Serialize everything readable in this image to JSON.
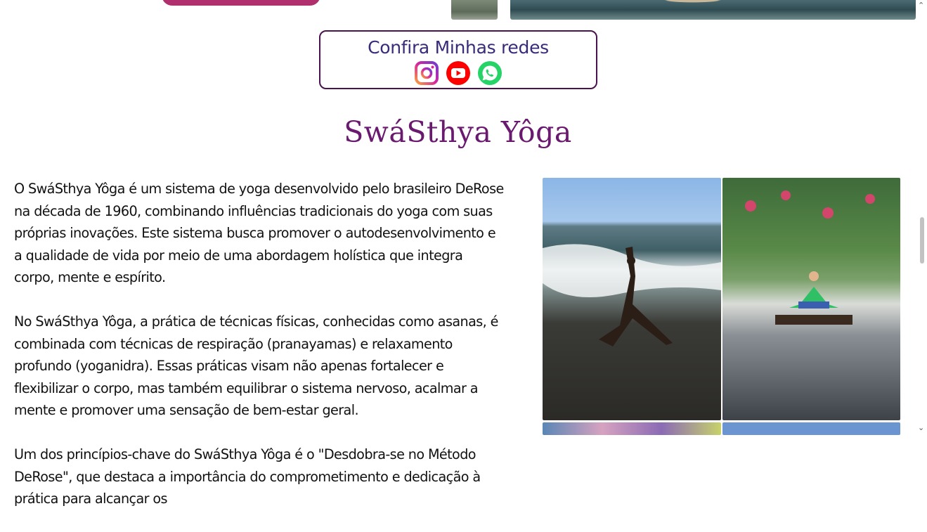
{
  "social": {
    "title": "Confira Minhas redes",
    "icons": [
      "instagram-icon",
      "youtube-icon",
      "whatsapp-icon"
    ]
  },
  "section": {
    "title": "SwáSthya Yôga"
  },
  "article": {
    "paragraphs": [
      "O SwáSthya Yôga é um sistema de yoga desenvolvido pelo brasileiro DeRose na década de 1960, combinando influências tradicionais do yoga com suas próprias inovações. Este sistema busca promover o autodesenvolvimento e a qualidade de vida por meio de uma abordagem holística que integra corpo, mente e espírito.",
      "No SwáSthya Yôga, a prática de técnicas físicas, conhecidas como asanas, é combinada com técnicas de respiração (pranayamas) e relaxamento profundo (yoganidra). Essas práticas visam não apenas fortalecer e flexibilizar o corpo, mas também equilibrar o sistema nervoso, acalmar a mente e promover uma sensação de bem-estar geral.",
      "Um dos princípios-chave do SwáSthya Yôga é o \"Desdobra-se no Método DeRose\", que destaca a importância do comprometimento e dedicação à prática para alcançar os"
    ]
  },
  "colors": {
    "accent": "#6a1a6e",
    "button": "#b0306e",
    "social_title": "#3a2a7a",
    "instagram": "#d6249f",
    "youtube": "#ff0000",
    "whatsapp": "#25d366"
  },
  "scrollbar": {
    "up": "⌃",
    "down": "⌄"
  }
}
